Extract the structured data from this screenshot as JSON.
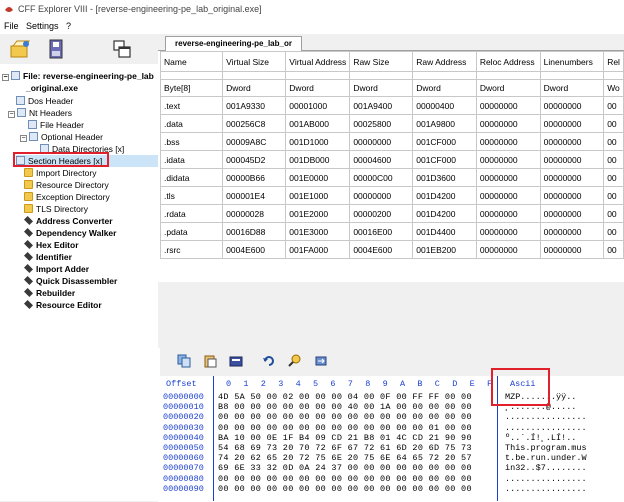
{
  "window": {
    "title": "CFF Explorer VIII - [reverse-engineering-pe_lab_original.exe]"
  },
  "menu": [
    "File",
    "Settings",
    "?"
  ],
  "tab": {
    "label": "reverse-engineering-pe_lab_or"
  },
  "tree": {
    "file_line1": "File: reverse-engineering-pe_lab",
    "file_line2": "_original.exe",
    "items": [
      "Dos Header",
      "Nt Headers",
      "File Header",
      "Optional Header",
      "Data Directories [x]",
      "Section Headers [x]",
      "Import Directory",
      "Resource Directory",
      "Exception Directory",
      "TLS Directory",
      "Address Converter",
      "Dependency Walker",
      "Hex Editor",
      "Identifier",
      "Import Adder",
      "Quick Disassembler",
      "Rebuilder",
      "Resource Editor"
    ]
  },
  "grid": {
    "headers": [
      "Name",
      "Virtual Size",
      "Virtual Address",
      "Raw Size",
      "Raw Address",
      "Reloc Address",
      "Linenumbers",
      "Rel"
    ],
    "types": [
      "Byte[8]",
      "Dword",
      "Dword",
      "Dword",
      "Dword",
      "Dword",
      "Dword",
      "Wo"
    ],
    "rows": [
      [
        ".text",
        "001A9330",
        "00001000",
        "001A9400",
        "00000400",
        "00000000",
        "00000000",
        "00"
      ],
      [
        ".data",
        "000256C8",
        "001AB000",
        "00025800",
        "001A9800",
        "00000000",
        "00000000",
        "00"
      ],
      [
        ".bss",
        "00009A8C",
        "001D1000",
        "00000000",
        "001CF000",
        "00000000",
        "00000000",
        "00"
      ],
      [
        ".idata",
        "000045D2",
        "001DB000",
        "00004600",
        "001CF000",
        "00000000",
        "00000000",
        "00"
      ],
      [
        ".didata",
        "00000B66",
        "001E0000",
        "00000C00",
        "001D3600",
        "00000000",
        "00000000",
        "00"
      ],
      [
        ".tls",
        "000001E4",
        "001E1000",
        "00000000",
        "001D4200",
        "00000000",
        "00000000",
        "00"
      ],
      [
        ".rdata",
        "00000028",
        "001E2000",
        "00000200",
        "001D4200",
        "00000000",
        "00000000",
        "00"
      ],
      [
        ".pdata",
        "00016D88",
        "001E3000",
        "00016E00",
        "001D4400",
        "00000000",
        "00000000",
        "00"
      ],
      [
        ".rsrc",
        "0004E600",
        "001FA000",
        "0004E600",
        "001EB200",
        "00000000",
        "00000000",
        "00"
      ]
    ]
  },
  "hex": {
    "offset_label": "Offset",
    "columns": [
      "0",
      "1",
      "2",
      "3",
      "4",
      "5",
      "6",
      "7",
      "8",
      "9",
      "A",
      "B",
      "C",
      "D",
      "E",
      "F"
    ],
    "ascii_label": "Ascii",
    "offsets": [
      "00000000",
      "00000010",
      "00000020",
      "00000030",
      "00000040",
      "00000050",
      "00000060",
      "00000070",
      "00000080",
      "00000090"
    ],
    "bytes": [
      "4D 5A 50 00 02 00 00 00 04 00 0F 00 FF FF 00 00",
      "B8 00 00 00 00 00 00 00 40 00 1A 00 00 00 00 00",
      "00 00 00 00 00 00 00 00 00 00 00 00 00 00 00 00",
      "00 00 00 00 00 00 00 00 00 00 00 00 00 01 00 00",
      "BA 10 00 0E 1F B4 09 CD 21 B8 01 4C CD 21 90 90",
      "54 68 69 73 20 70 72 6F 67 72 61 6D 20 6D 75 73",
      "74 20 62 65 20 72 75 6E 20 75 6E 64 65 72 20 57",
      "69 6E 33 32 0D 0A 24 37 00 00 00 00 00 00 00 00",
      "00 00 00 00 00 00 00 00 00 00 00 00 00 00 00 00",
      "00 00 00 00 00 00 00 00 00 00 00 00 00 00 00 00"
    ],
    "ascii": [
      "MZP.......ÿÿ..",
      "¸.......@.....",
      "................",
      "................",
      "º..´.Í!¸.LÍ!..",
      "This.program.mus",
      "t.be.run.under.W",
      "in32..$7........",
      "................",
      "................"
    ]
  },
  "colors": {
    "highlight_box": "#e0202a",
    "hex_label": "#1a3fd1",
    "selection": "#cce4f7"
  }
}
